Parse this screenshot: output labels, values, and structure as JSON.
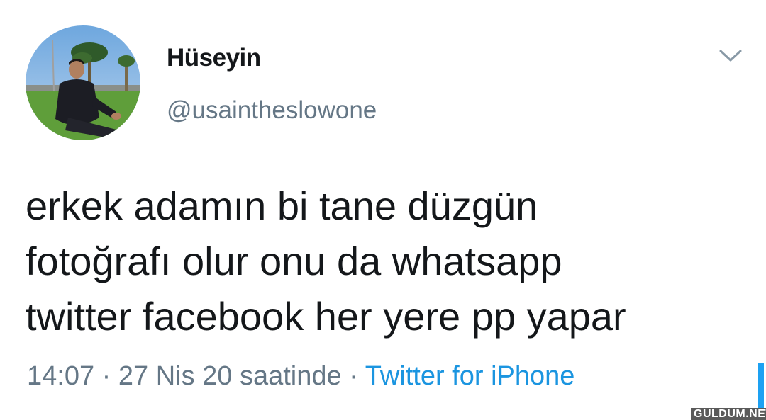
{
  "tweet": {
    "user": {
      "display_name": "Hüseyin",
      "handle": "@usaintheslowone"
    },
    "text_lines": [
      "erkek adamın bi tane düzgün",
      "fotoğrafı olur onu da whatsapp",
      "twitter facebook her yere pp yapar"
    ],
    "timestamp": "14:07 · 27 Nis 20 saatinde · ",
    "source": "Twitter for iPhone",
    "menu_icon": "chevron-down-icon"
  },
  "watermark": "GULDUM.NET",
  "colors": {
    "text": "#14171a",
    "secondary": "#657786",
    "link": "#1b95e0"
  }
}
